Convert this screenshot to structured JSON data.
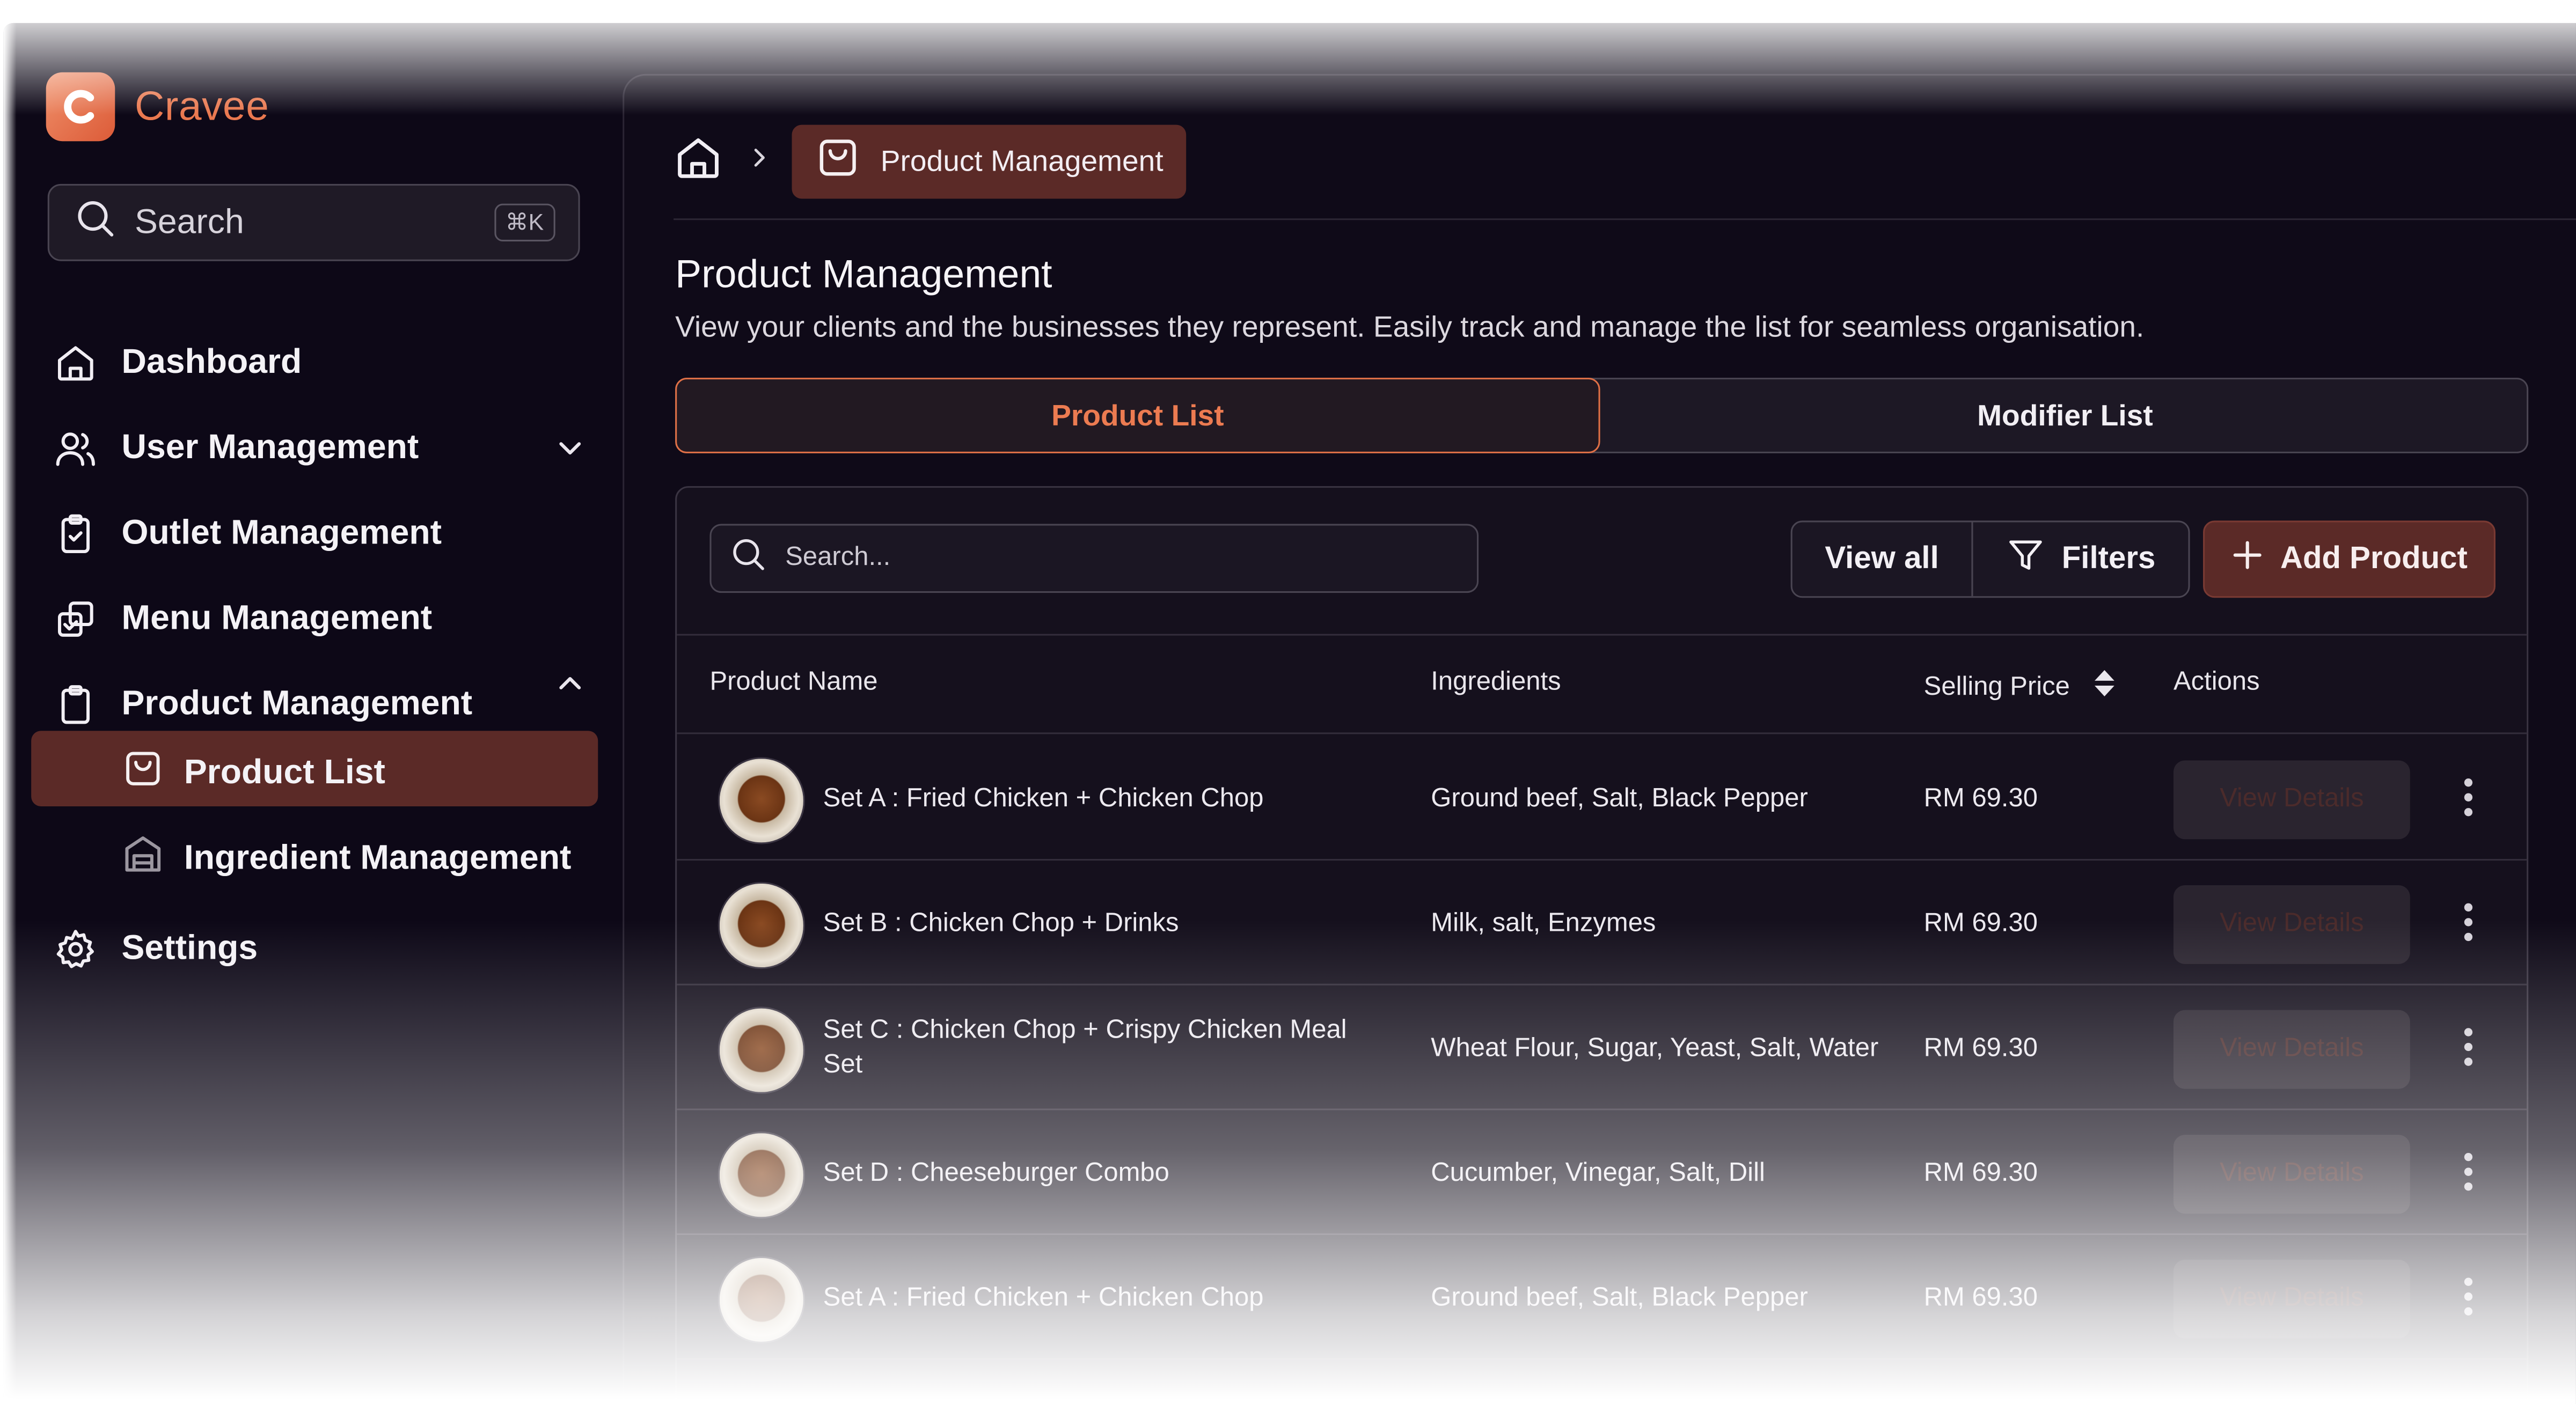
{
  "brand": {
    "name": "Cravee",
    "accent": "#e9784f"
  },
  "sidebar": {
    "search_label": "Search",
    "search_shortcut": "⌘K",
    "items": [
      {
        "label": "Dashboard",
        "icon": "home-icon"
      },
      {
        "label": "User Management",
        "icon": "users-icon",
        "expand": "chevron-down-icon"
      },
      {
        "label": "Outlet Management",
        "icon": "clipboard-check-icon"
      },
      {
        "label": "Menu Management",
        "icon": "copy-check-icon"
      },
      {
        "label": "Product Management",
        "icon": "clipboard-icon",
        "expand": "chevron-up-icon"
      }
    ],
    "sub_items": [
      {
        "label": "Product List",
        "icon": "shopping-bag-icon",
        "active": true
      },
      {
        "label": "Ingredient Management",
        "icon": "warehouse-icon"
      }
    ],
    "settings_label": "Settings"
  },
  "breadcrumb": {
    "current": "Product Management"
  },
  "page": {
    "title": "Product Management",
    "subtitle": "View your clients and the businesses they represent. Easily track and manage the list for seamless organisation."
  },
  "tabs": [
    {
      "label": "Product List",
      "active": true
    },
    {
      "label": "Modifier List",
      "active": false
    }
  ],
  "toolbar": {
    "search_placeholder": "Search...",
    "view_all_label": "View all",
    "filters_label": "Filters",
    "add_label": "Add Product"
  },
  "table": {
    "columns": [
      "Product Name",
      "Ingredients",
      "Selling Price",
      "Actions"
    ],
    "rows": [
      {
        "name": "Set A : Fried Chicken + Chicken Chop",
        "ingredients": "Ground beef, Salt, Black Pepper",
        "price": "RM 69.30",
        "action": "View Details"
      },
      {
        "name": "Set B : Chicken Chop + Drinks",
        "ingredients": "Milk, salt, Enzymes",
        "price": "RM 69.30",
        "action": "View Details"
      },
      {
        "name": "Set C : Chicken Chop + Crispy Chicken Meal Set",
        "ingredients": "Wheat Flour, Sugar, Yeast, Salt, Water",
        "price": "RM 69.30",
        "action": "View Details"
      },
      {
        "name": "Set D : Cheeseburger Combo",
        "ingredients": "Cucumber, Vinegar, Salt, Dill",
        "price": "RM 69.30",
        "action": "View Details"
      },
      {
        "name": "Set A : Fried Chicken + Chicken Chop",
        "ingredients": "Ground beef, Salt, Black Pepper",
        "price": "RM 69.30",
        "action": "View Details"
      }
    ]
  }
}
